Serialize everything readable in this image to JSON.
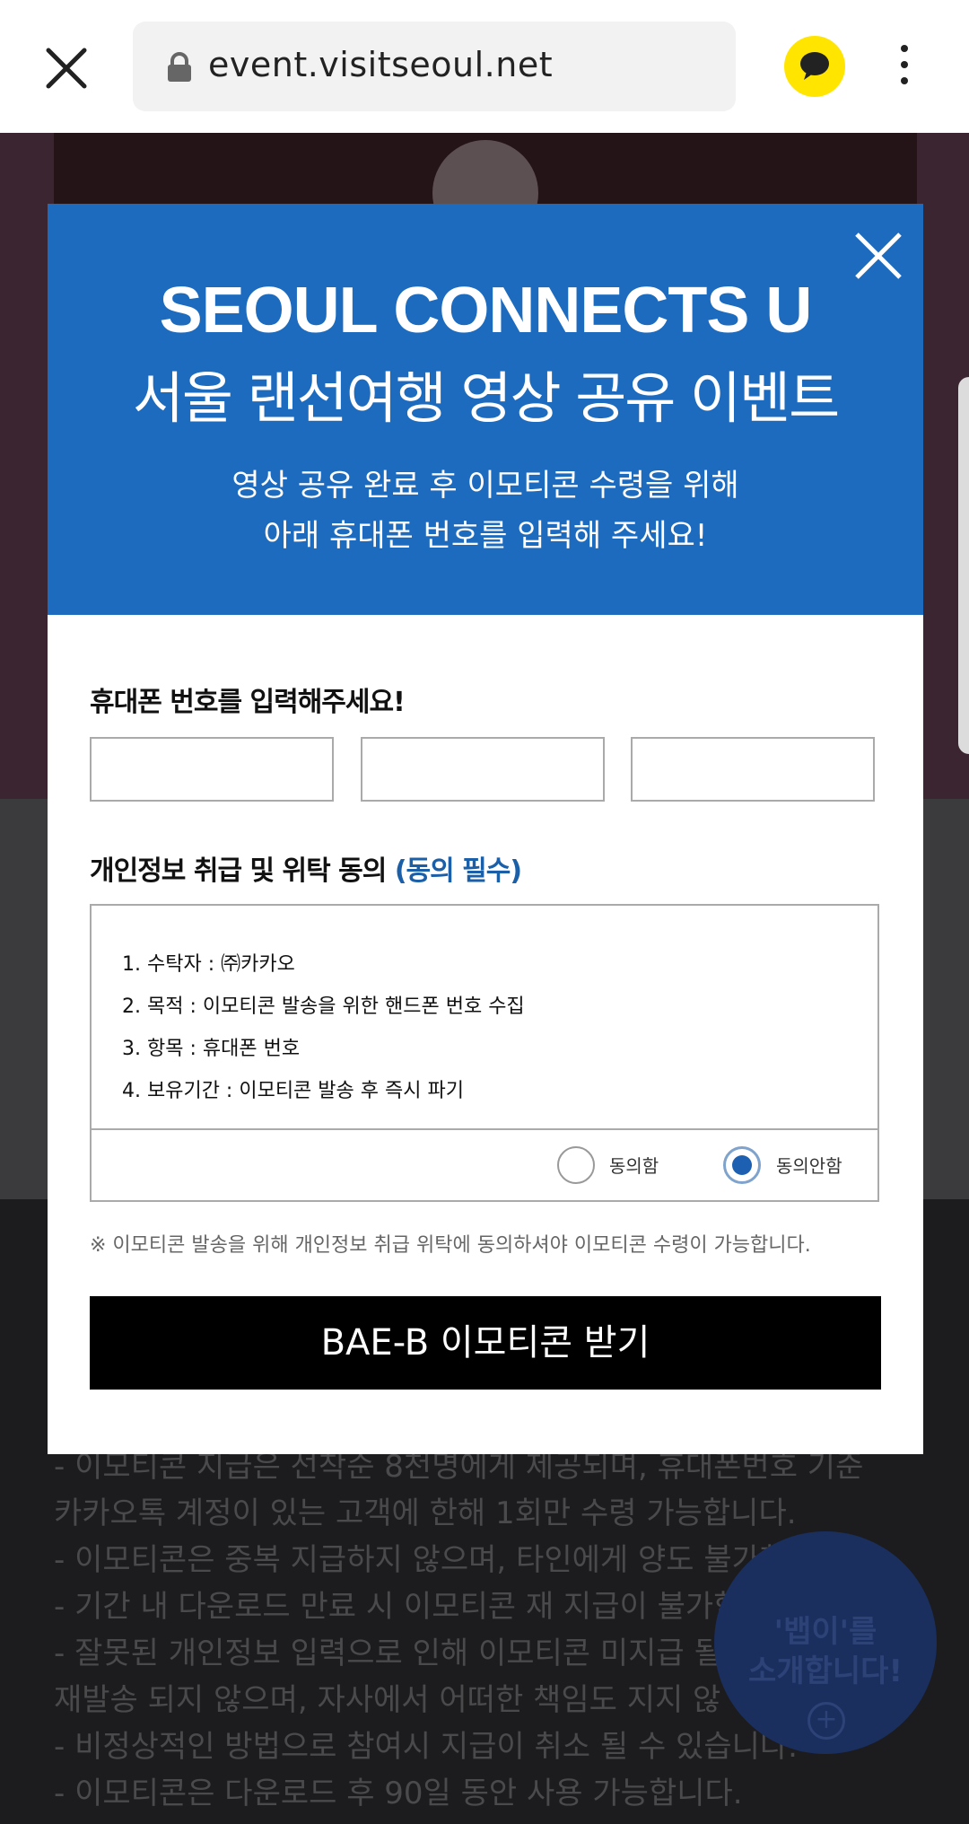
{
  "browser": {
    "url": "event.visitseoul.net",
    "close_icon": "close-icon",
    "lock_icon": "lock-icon",
    "kakao_icon": "kakao-talk-icon",
    "more_icon": "more-vertical-icon"
  },
  "background": {
    "notes": [
      "- 이모티콘 지급은 선착순 8천명에게 제공되며, 휴대폰번호 기준",
      "  카카오톡 계정이 있는 고객에 한해 1회만 수령 가능합니다.",
      "- 이모티콘은 중복 지급하지 않으며, 타인에게 양도 불가합",
      "- 기간 내 다운로드 만료 시 이모티콘 재 지급이 불가합",
      "- 잘못된 개인정보 입력으로 인해 이모티콘 미지급 될",
      "  재발송 되지 않으며, 자사에서 어떠한 책임도 지지 않",
      "- 비정상적인 방법으로 참여시 지급이 취소 될 수 있습니다.",
      "- 이모티콘은 다운로드 후 90일 동안 사용 가능합니다."
    ],
    "badge_line1": "'뱁이'를",
    "badge_line2": "소개합니다!",
    "badge_plus": "+"
  },
  "modal": {
    "title": "SEOUL CONNECTS U",
    "subtitle": "서울 랜선여행 영상 공유 이벤트",
    "desc_line1": "영상 공유 완료 후 이모티콘 수령을 위해",
    "desc_line2": "아래 휴대폰 번호를 입력해 주세요!",
    "phone_label": "휴대폰 번호를 입력해주세요!",
    "phone_fields": [
      "",
      "",
      ""
    ],
    "consent_label": "개인정보 취급 및 위탁 동의 ",
    "consent_required": "(동의 필수)",
    "terms": [
      "1. 수탁자 : ㈜카카오",
      "2. 목적 : 이모티콘 발송을 위한 핸드폰 번호 수집",
      "3. 항목 : 휴대폰 번호",
      "4. 보유기간 : 이모티콘 발송 후 즉시 파기"
    ],
    "agree_label": "동의함",
    "disagree_label": "동의안함",
    "selected": "동의안함",
    "notice": "※ 이모티콘 발송을 위해 개인정보 취급 위탁에 동의하셔야 이모티콘 수령이 가능합니다.",
    "submit_label": "BAE-B 이모티콘 받기"
  },
  "colors": {
    "header_blue": "#1d6bbf",
    "accent_blue": "#1a5fa8",
    "kakao_yellow": "#FFE500"
  }
}
